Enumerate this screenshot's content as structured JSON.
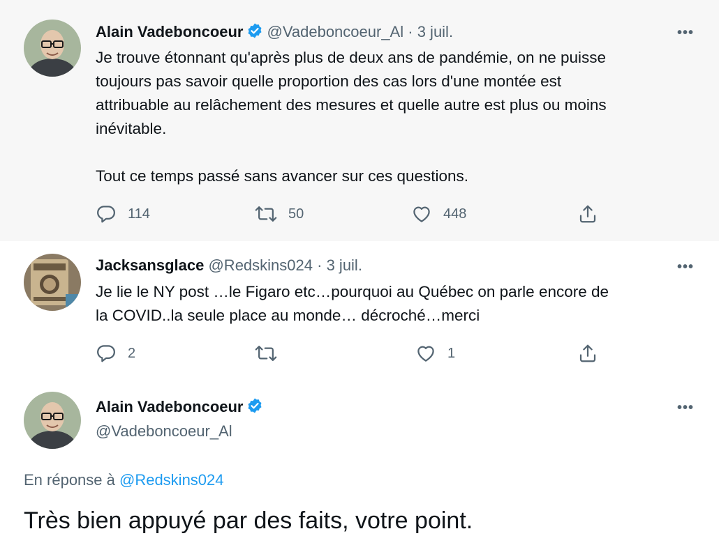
{
  "tweets": [
    {
      "name": "Alain Vadeboncoeur",
      "handle": "@Vadeboncoeur_Al",
      "separator": "·",
      "date": "3 juil.",
      "more": "•••",
      "text": "Je trouve étonnant qu'après plus de deux ans de pandémie, on ne puisse\ntoujours pas savoir quelle proportion des cas lors d'une montée est\nattribuable au relâchement des mesures et quelle autre est plus ou moins\ninévitable.\n\nTout ce temps passé sans avancer sur ces questions.",
      "replies": "114",
      "retweets": "50",
      "likes": "448"
    },
    {
      "name": "Jacksansglace",
      "handle": "@Redskins024",
      "separator": "·",
      "date": "3 juil.",
      "more": "•••",
      "text": "Je lie le NY post …le Figaro etc…pourquoi au Québec on parle encore de\nla COVID..la seule place au monde… décroché…merci",
      "replies": "2",
      "retweets": "",
      "likes": "1"
    },
    {
      "name": "Alain Vadeboncoeur",
      "handle": "@Vadeboncoeur_Al",
      "more": "•••",
      "replying_prefix": "En réponse à ",
      "replying_mention": "@Redskins024",
      "text": "Très bien appuyé par des faits, votre point."
    }
  ],
  "icons": {
    "reply": "reply-icon",
    "retweet": "retweet-icon",
    "like": "heart-icon",
    "share": "share-icon",
    "verified": "verified-badge-icon"
  },
  "colors": {
    "accent": "#1d9bf0",
    "text": "#0f1419",
    "muted": "#536471",
    "highlight_bg": "#f7f7f7",
    "thread_line": "#cfd9de"
  }
}
